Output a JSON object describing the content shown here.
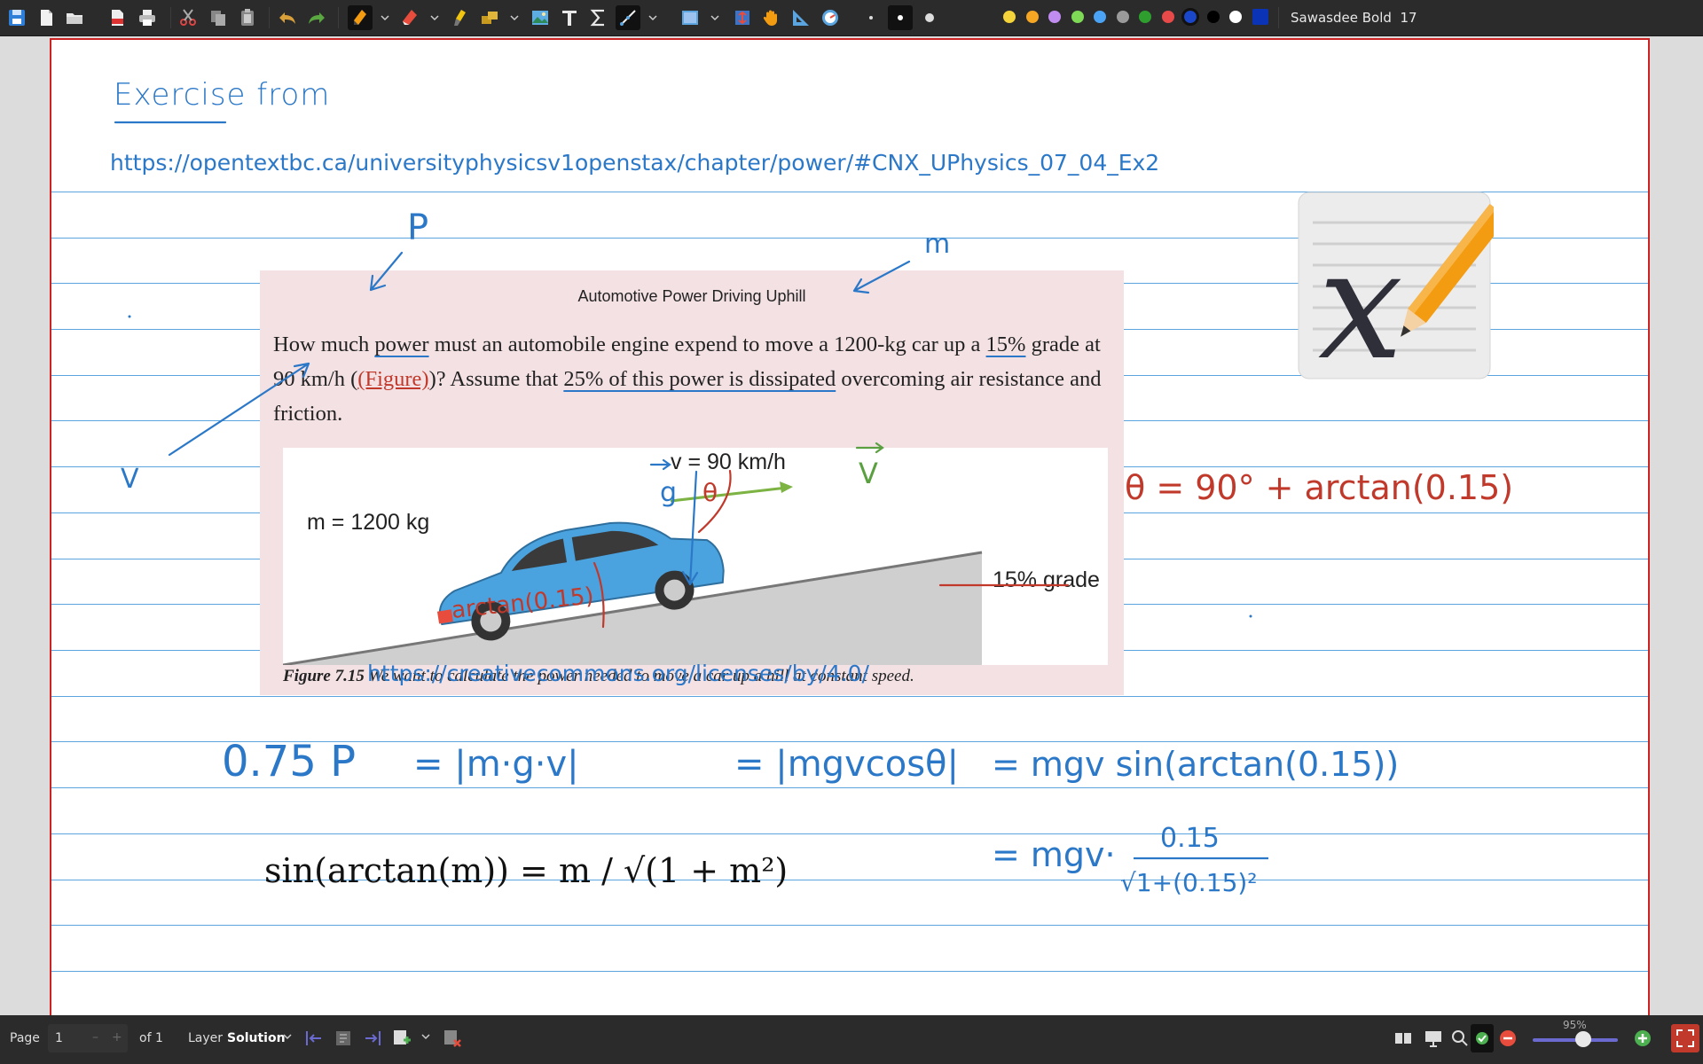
{
  "toolbar": {
    "font_name": "Sawasdee Bold",
    "font_size": "17",
    "icons": [
      "save-icon",
      "new-page-icon",
      "open-icon",
      "export-pdf-icon",
      "print-icon",
      "cut-icon",
      "copy-icon",
      "paste-icon",
      "undo-icon",
      "redo-icon",
      "pen-icon",
      "eraser-icon",
      "highlighter-icon",
      "shape-icon",
      "image-icon",
      "text-icon",
      "latex-icon",
      "select-icon",
      "rect-select-icon",
      "vertical-space-icon",
      "hand-icon",
      "ruler-icon",
      "compass-icon"
    ],
    "colors": [
      "#f5d33a",
      "#f5a623",
      "#c08cf0",
      "#7ed957",
      "#4ba3f5",
      "#9a9a9a",
      "#2e9e2e",
      "#e84a4a",
      "#1a47c9",
      "#000000",
      "#ffffff",
      "#0a34b5"
    ]
  },
  "page": {
    "heading": "Exercise from",
    "source_url": "https://opentextbc.ca/universityphysicsv1openstax/chapter/power/#CNX_UPhysics_07_04_Ex2",
    "license_url": "https://creativecommons.org/licenses/by/4.0/",
    "figure": {
      "title": "Automotive Power Driving Uphill",
      "q_p1": "How much ",
      "q_power": "power",
      "q_p2": " must an automobile engine expend to move a 1200-kg car up a ",
      "q_grade": "15%",
      "q_p3": " grade at 90 km/h (",
      "q_ref": "(Figure)",
      "q_p4": ")? Assume that ",
      "q_diss": "25% of this power is dissipated",
      "q_p5": " overcoming air resistance and friction.",
      "img_velocity": "v = 90 km/h",
      "img_mass": "m = 1200 kg",
      "img_grade": "15% grade",
      "caption_label": "Figure 7.15",
      "caption_text": " We want to calculate the power needed to move a car up a hill at constant speed."
    },
    "annotations": {
      "p": "P",
      "m": "m",
      "v": "V",
      "g": "g",
      "theta": "θ",
      "arctan": "arctan(0.15)",
      "v_arrow": "V",
      "theta_eq": "θ = 90° + arctan(0.15)",
      "eq_lhs": "0.75 P",
      "eq1": "= |m·g·v|",
      "eq2": "= |mgvcosθ|",
      "eq3": "= mgv sin(arctan(0.15))",
      "eq4_prefix": "= mgv·",
      "eq4_num": "0.15",
      "eq4_den": "√1+(0.15)²"
    },
    "latex_formula": "sin(arctan(m)) = m / √(1 + m²)"
  },
  "statusbar": {
    "page_label": "Page",
    "page_value": "1",
    "page_of": "of 1",
    "layer_label": "Layer",
    "layer_value": "Solution",
    "zoom": "95%",
    "zoom_value": 0.95
  }
}
